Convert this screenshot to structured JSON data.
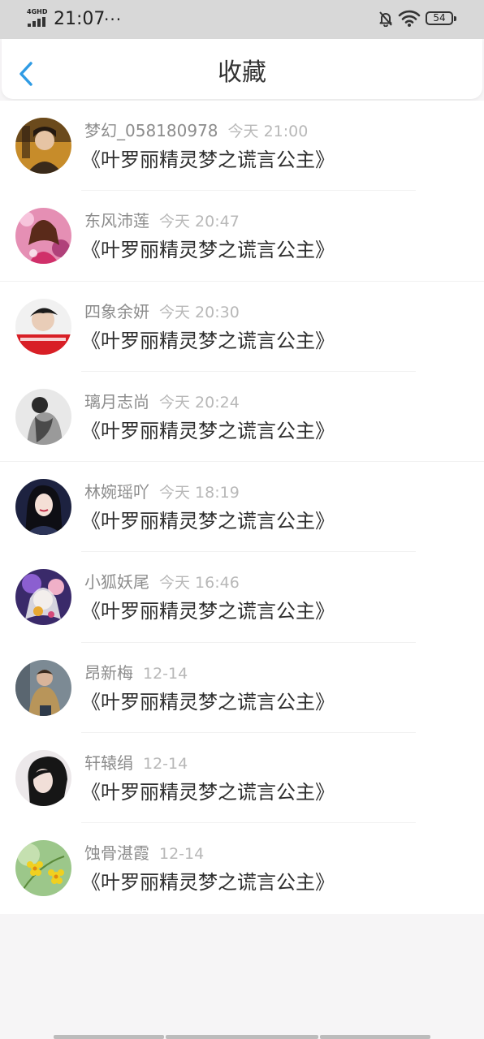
{
  "status_bar": {
    "network": "4GHD",
    "time": "21:07",
    "dots": "···",
    "battery": "54"
  },
  "header": {
    "title": "收藏"
  },
  "favorites": [
    {
      "user": "梦幻_058180978",
      "time": "今天 21:00",
      "book": "《叶罗丽精灵梦之谎言公主》"
    },
    {
      "user": "东风沛莲",
      "time": "今天 20:47",
      "book": "《叶罗丽精灵梦之谎言公主》"
    },
    {
      "user": "四象余妍",
      "time": "今天 20:30",
      "book": "《叶罗丽精灵梦之谎言公主》"
    },
    {
      "user": "璃月志尚",
      "time": "今天 20:24",
      "book": "《叶罗丽精灵梦之谎言公主》"
    },
    {
      "user": "林婉瑶吖",
      "time": "今天 18:19",
      "book": "《叶罗丽精灵梦之谎言公主》"
    },
    {
      "user": "小狐妖尾",
      "time": "今天 16:46",
      "book": "《叶罗丽精灵梦之谎言公主》"
    },
    {
      "user": "昂新梅",
      "time": "12-14",
      "book": "《叶罗丽精灵梦之谎言公主》"
    },
    {
      "user": "轩辕绢",
      "time": "12-14",
      "book": "《叶罗丽精灵梦之谎言公主》"
    },
    {
      "user": "蚀骨湛霞",
      "time": "12-14",
      "book": "《叶罗丽精灵梦之谎言公主》"
    }
  ],
  "colors": {
    "accent": "#2f9be4",
    "title_text": "#333333",
    "username_text": "#8c8c8c",
    "time_text": "#b8b8b8",
    "status_bar_bg": "#d8d8d8",
    "page_bg": "#f6f5f6"
  }
}
